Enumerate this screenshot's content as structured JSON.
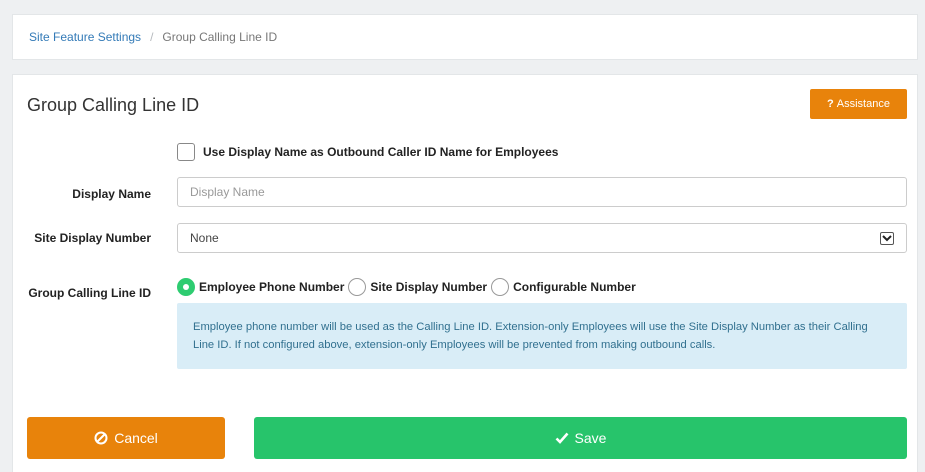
{
  "breadcrumb": {
    "link": "Site Feature Settings",
    "separator": "/",
    "current": "Group Calling Line ID"
  },
  "panel": {
    "title": "Group Calling Line ID",
    "assistance_label": "Assistance"
  },
  "form": {
    "use_display_name_checkbox": {
      "label": "Use Display Name as Outbound Caller ID Name for Employees",
      "checked": false
    },
    "display_name": {
      "label": "Display Name",
      "value": "",
      "placeholder": "Display Name"
    },
    "site_display_number": {
      "label": "Site Display Number",
      "selected": "None"
    },
    "group_calling_line_id": {
      "label": "Group Calling Line ID",
      "options": [
        {
          "label": "Employee Phone Number",
          "checked": true
        },
        {
          "label": "Site Display Number",
          "checked": false
        },
        {
          "label": "Configurable Number",
          "checked": false
        }
      ],
      "info": "Employee phone number will be used as the Calling Line ID. Extension-only Employees will use the Site Display Number as their Calling Line ID. If not configured above, extension-only Employees will be prevented from making outbound calls."
    }
  },
  "actions": {
    "cancel_label": "Cancel",
    "save_label": "Save"
  },
  "colors": {
    "link": "#337ab7",
    "orange": "#e8830b",
    "green": "#27c46b",
    "info_bg": "#d9edf7",
    "info_text": "#31708f"
  }
}
